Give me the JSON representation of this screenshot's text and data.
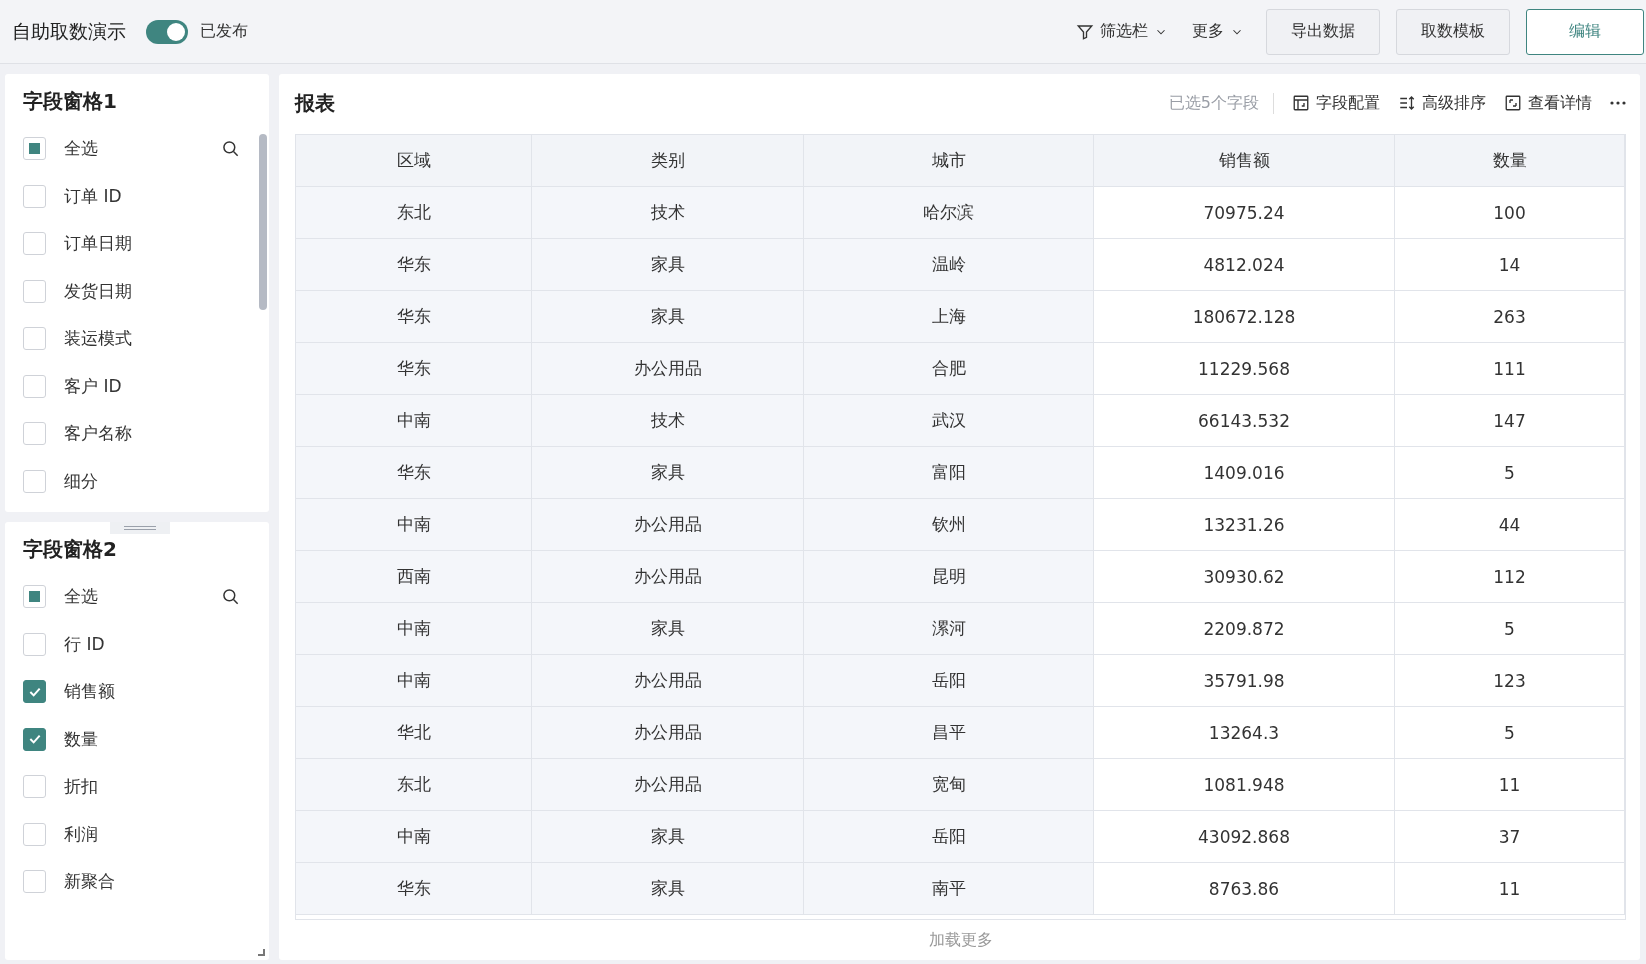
{
  "header": {
    "title": "自助取数演示",
    "published": {
      "on": true,
      "label": "已发布"
    },
    "filter": "筛选栏",
    "more": "更多",
    "buttons": [
      {
        "label": "导出数据",
        "kind": "default"
      },
      {
        "label": "取数模板",
        "kind": "default"
      },
      {
        "label": "编辑",
        "kind": "primary"
      }
    ]
  },
  "panes": [
    {
      "title": "字段窗格1",
      "select_all": {
        "label": "全选",
        "indeterminate": true
      },
      "scrollbar": true,
      "fields": [
        {
          "label": "订单 ID",
          "checked": false
        },
        {
          "label": "订单日期",
          "checked": false
        },
        {
          "label": "发货日期",
          "checked": false
        },
        {
          "label": "装运模式",
          "checked": false
        },
        {
          "label": "客户 ID",
          "checked": false
        },
        {
          "label": "客户名称",
          "checked": false
        },
        {
          "label": "细分",
          "checked": false
        }
      ]
    },
    {
      "title": "字段窗格2",
      "select_all": {
        "label": "全选",
        "indeterminate": true
      },
      "scrollbar": false,
      "fields": [
        {
          "label": "行 ID",
          "checked": false
        },
        {
          "label": "销售额",
          "checked": true
        },
        {
          "label": "数量",
          "checked": true
        },
        {
          "label": "折扣",
          "checked": false
        },
        {
          "label": "利润",
          "checked": false
        },
        {
          "label": "新聚合",
          "checked": false
        }
      ]
    }
  ],
  "report": {
    "title": "报表",
    "selected_count": "已选5个字段",
    "actions": [
      {
        "label": "字段配置",
        "kind": "config"
      },
      {
        "label": "高级排序",
        "kind": "sort"
      },
      {
        "label": "查看详情",
        "kind": "detail"
      }
    ],
    "table": {
      "columns": [
        "区域",
        "类别",
        "城市",
        "销售额",
        "数量"
      ],
      "rows": [
        [
          "东北",
          "技术",
          "哈尔滨",
          "70975.24",
          "100"
        ],
        [
          "华东",
          "家具",
          "温岭",
          "4812.024",
          "14"
        ],
        [
          "华东",
          "家具",
          "上海",
          "180672.128",
          "263"
        ],
        [
          "华东",
          "办公用品",
          "合肥",
          "11229.568",
          "111"
        ],
        [
          "中南",
          "技术",
          "武汉",
          "66143.532",
          "147"
        ],
        [
          "华东",
          "家具",
          "富阳",
          "1409.016",
          "5"
        ],
        [
          "中南",
          "办公用品",
          "钦州",
          "13231.26",
          "44"
        ],
        [
          "西南",
          "办公用品",
          "昆明",
          "30930.62",
          "112"
        ],
        [
          "中南",
          "家具",
          "漯河",
          "2209.872",
          "5"
        ],
        [
          "中南",
          "办公用品",
          "岳阳",
          "35791.98",
          "123"
        ],
        [
          "华北",
          "办公用品",
          "昌平",
          "13264.3",
          "5"
        ],
        [
          "东北",
          "办公用品",
          "宽甸",
          "1081.948",
          "11"
        ],
        [
          "中南",
          "家具",
          "岳阳",
          "43092.868",
          "37"
        ],
        [
          "华东",
          "家具",
          "南平",
          "8763.86",
          "11"
        ]
      ]
    },
    "load_more": "加载更多"
  }
}
